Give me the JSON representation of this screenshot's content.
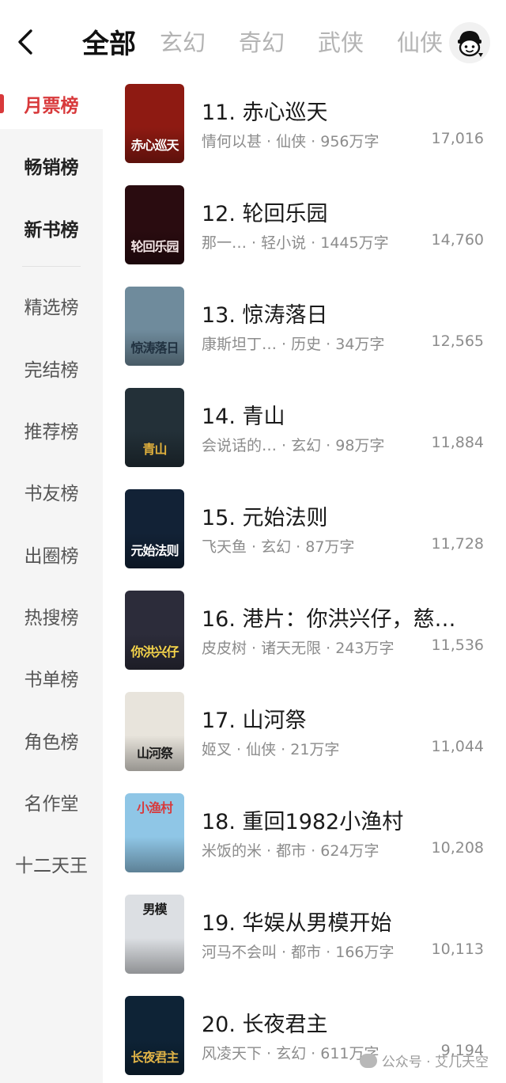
{
  "header": {
    "tabs": [
      {
        "label": "全部",
        "active": true
      },
      {
        "label": "玄幻"
      },
      {
        "label": "奇幻"
      },
      {
        "label": "武侠"
      },
      {
        "label": "仙侠"
      }
    ],
    "back_icon": "chevron-left-icon",
    "profile_icon": "face-avatar-icon"
  },
  "sidebar": {
    "items": [
      {
        "label": "月票榜",
        "state": "active"
      },
      {
        "label": "畅销榜",
        "state": "strong"
      },
      {
        "label": "新书榜",
        "state": "strong"
      },
      {
        "label": "精选榜"
      },
      {
        "label": "完结榜"
      },
      {
        "label": "推荐榜"
      },
      {
        "label": "书友榜"
      },
      {
        "label": "出圈榜"
      },
      {
        "label": "热搜榜"
      },
      {
        "label": "书单榜"
      },
      {
        "label": "角色榜"
      },
      {
        "label": "名作堂"
      },
      {
        "label": "十二天王"
      }
    ]
  },
  "books": [
    {
      "title": "11. 赤心巡天",
      "meta": "情何以甚 · 仙侠 · 956万字",
      "count": "17,016",
      "cover_text": "赤心巡天",
      "cover_bg": "#8e1a12",
      "cover_fg": "#ffffff"
    },
    {
      "title": "12. 轮回乐园",
      "meta": "那一…  · 轻小说 · 1445万字",
      "count": "14,760",
      "cover_text": "轮回乐园",
      "cover_bg": "#2a0c10",
      "cover_fg": "#f3e5e5"
    },
    {
      "title": "13. 惊涛落日",
      "meta": "康斯坦丁…  · 历史 · 34万字",
      "count": "12,565",
      "cover_text": "惊涛落日",
      "cover_bg": "#6f8b9c",
      "cover_fg": "#203140"
    },
    {
      "title": "14. 青山",
      "meta": "会说话的…  · 玄幻 · 98万字",
      "count": "11,884",
      "cover_text": "青山",
      "cover_bg": "#233038",
      "cover_fg": "#e2b13c"
    },
    {
      "title": "15. 元始法则",
      "meta": "飞天鱼 · 玄幻 · 87万字",
      "count": "11,728",
      "cover_text": "元始法则",
      "cover_bg": "#122236",
      "cover_fg": "#ffffff"
    },
    {
      "title": "16. 港片：你洪兴仔，慈…",
      "meta": "皮皮树 · 诸天无限 · 243万字",
      "count": "11,536",
      "cover_text": "你洪兴仔",
      "cover_bg": "#2c2c3a",
      "cover_fg": "#f5d44a"
    },
    {
      "title": "17. 山河祭",
      "meta": "姬叉 · 仙侠 · 21万字",
      "count": "11,044",
      "cover_text": "山河祭",
      "cover_bg": "#e8e4dc",
      "cover_fg": "#1a1a1a"
    },
    {
      "title": "18. 重回1982小渔村",
      "meta": "米饭的米 · 都市 · 624万字",
      "count": "10,208",
      "cover_text": "小渔村",
      "cover_bg": "#8fc6e6",
      "cover_fg": "#d8393b",
      "cover_top": true
    },
    {
      "title": "19. 华娱从男模开始",
      "meta": "河马不会叫 · 都市 · 166万字",
      "count": "10,113",
      "cover_text": "男模",
      "cover_bg": "#dcdfe3",
      "cover_fg": "#1a1a1a",
      "cover_top": true
    },
    {
      "title": "20. 长夜君主",
      "meta": "风凌天下 · 玄幻 · 611万字",
      "count": "9,194",
      "cover_text": "长夜君主",
      "cover_bg": "#0e2336",
      "cover_fg": "#e0b347"
    }
  ],
  "watermark": {
    "text": "公众号 · 艾几天空"
  },
  "colors": {
    "accent": "#d8393b",
    "sidebar_bg": "#f5f5f5",
    "muted_text": "#8c8c8c"
  }
}
